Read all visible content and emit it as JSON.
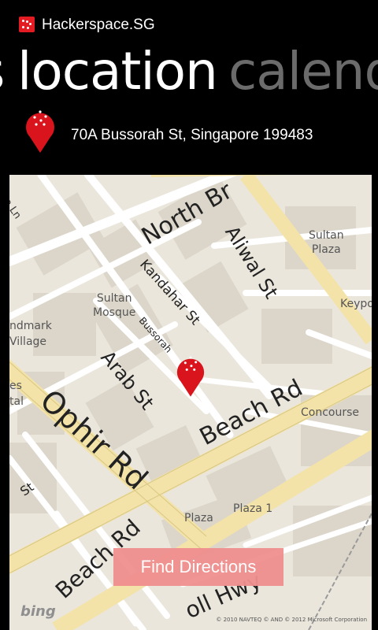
{
  "app": {
    "title": "Hackerspace.SG"
  },
  "pivot": {
    "active": "location",
    "next": "calendar"
  },
  "location": {
    "address": "70A Bussorah St, Singapore 199483"
  },
  "map": {
    "streets": {
      "north_bridge": "North Br",
      "aliwal": "Aliwal St",
      "kandahar": "Kandahar St",
      "bussorah": "Bussorah",
      "arab": "Arab St",
      "ophir": "Ophir Rd",
      "beach_rd": "Beach Rd",
      "beach_rd_2": "Beach Rd",
      "victoria": "oria Ln",
      "st_fragment": "St",
      "nicoll": "oll Hwy"
    },
    "places": {
      "sultan_plaza_1": "Sultan",
      "sultan_plaza_2": "Plaza",
      "sultan_mosque_1": "Sultan",
      "sultan_mosque_2": "Mosque",
      "landmark_1": "ndmark",
      "landmark_2": "Village",
      "keypoint": "Keypo",
      "es": "es",
      "tal": "tal",
      "concourse": "Concourse",
      "plaza": "Plaza",
      "plaza_1": "Plaza 1"
    },
    "bing_logo": "bing",
    "copyright": "© 2010 NAVTEQ  © AND  © 2012 Microsoft Corporation"
  },
  "actions": {
    "find_directions": "Find Directions"
  },
  "colors": {
    "accent": "#e31b23",
    "button": "#f08f8f"
  }
}
